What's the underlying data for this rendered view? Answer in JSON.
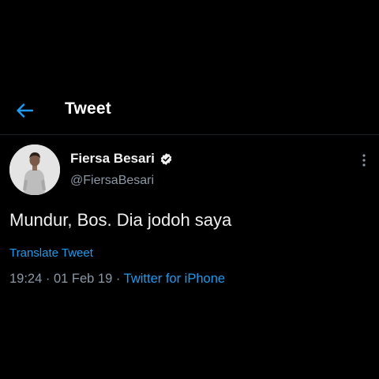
{
  "header": {
    "title": "Tweet",
    "back_icon": "arrow-left-icon"
  },
  "tweet": {
    "display_name": "Fiersa Besari",
    "verified": true,
    "username": "@FiersaBesari",
    "text": "Mundur, Bos. Dia jodoh saya",
    "translate_label": "Translate Tweet",
    "time": "19:24",
    "separator": " · ",
    "date": "01 Feb 19",
    "source": "Twitter for iPhone"
  },
  "colors": {
    "background": "#000000",
    "accent": "#1d9bf0",
    "secondary_text": "#8b98a5",
    "primary_text": "#e7e9ea"
  }
}
